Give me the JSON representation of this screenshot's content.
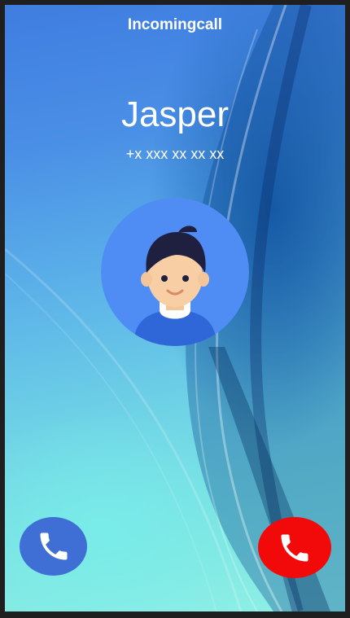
{
  "header": {
    "title": "Incomingcall"
  },
  "caller": {
    "name": "Jasper",
    "number": "+x xxx xx xx xx"
  },
  "actions": {
    "answer": {
      "icon": "phone-icon",
      "color": "#3f6fd4"
    },
    "decline": {
      "icon": "phone-hangup-icon",
      "color": "#f20a0a"
    }
  },
  "avatar": {
    "background": "#4f8df5"
  }
}
